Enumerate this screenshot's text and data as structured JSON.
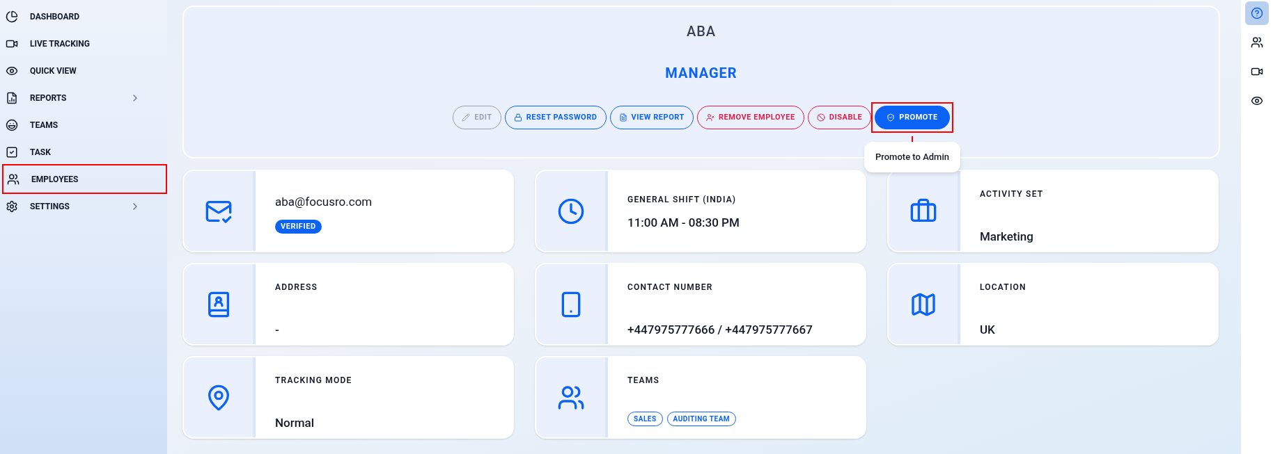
{
  "sidebar": {
    "items": [
      {
        "label": "DASHBOARD",
        "kind": "dashboard",
        "has_submenu": false,
        "highlighted": false
      },
      {
        "label": "LIVE TRACKING",
        "kind": "live",
        "has_submenu": false,
        "highlighted": false
      },
      {
        "label": "QUICK VIEW",
        "kind": "quick",
        "has_submenu": false,
        "highlighted": false
      },
      {
        "label": "REPORTS",
        "kind": "reports",
        "has_submenu": true,
        "highlighted": false
      },
      {
        "label": "TEAMS",
        "kind": "teams",
        "has_submenu": false,
        "highlighted": false
      },
      {
        "label": "TASK",
        "kind": "task",
        "has_submenu": false,
        "highlighted": false
      },
      {
        "label": "EMPLOYEES",
        "kind": "employees",
        "has_submenu": false,
        "highlighted": true
      },
      {
        "label": "SETTINGS",
        "kind": "settings",
        "has_submenu": true,
        "highlighted": false
      }
    ]
  },
  "profile": {
    "name": "ABA",
    "role": "MANAGER",
    "actions": [
      {
        "label": "EDIT",
        "kind": "edit",
        "disabled": true,
        "highlighted": false
      },
      {
        "label": "RESET PASSWORD",
        "kind": "lock",
        "disabled": false,
        "highlighted": false
      },
      {
        "label": "VIEW REPORT",
        "kind": "report",
        "disabled": false,
        "highlighted": false
      },
      {
        "label": "REMOVE EMPLOYEE",
        "kind": "remove",
        "disabled": false,
        "highlighted": false
      },
      {
        "label": "DISABLE",
        "kind": "disable",
        "disabled": false,
        "highlighted": false
      },
      {
        "label": "PROMOTE",
        "kind": "promote",
        "disabled": false,
        "highlighted": true,
        "tooltip": "Promote to Admin"
      }
    ]
  },
  "cards": [
    {
      "kind": "email",
      "value": "aba@focusro.com",
      "badge": "VERIFIED"
    },
    {
      "kind": "shift",
      "label": "GENERAL SHIFT (INDIA)",
      "value": "11:00 AM - 08:30 PM"
    },
    {
      "kind": "activity",
      "label": "ACTIVITY SET",
      "value": "Marketing"
    },
    {
      "kind": "address",
      "label": "ADDRESS",
      "value": "-"
    },
    {
      "kind": "contact",
      "label": "CONTACT NUMBER",
      "value": "+447975777666 / +447975777667"
    },
    {
      "kind": "location",
      "label": "LOCATION",
      "value": "UK"
    },
    {
      "kind": "tracking",
      "label": "TRACKING MODE",
      "value": "Normal"
    },
    {
      "kind": "teams",
      "label": "TEAMS",
      "tags": [
        "SALES",
        "AUDITING TEAM"
      ]
    }
  ],
  "right_rail": {
    "items": [
      {
        "kind": "help",
        "selected": true
      },
      {
        "kind": "users",
        "selected": false
      },
      {
        "kind": "video",
        "selected": false
      },
      {
        "kind": "eye",
        "selected": false
      }
    ]
  }
}
